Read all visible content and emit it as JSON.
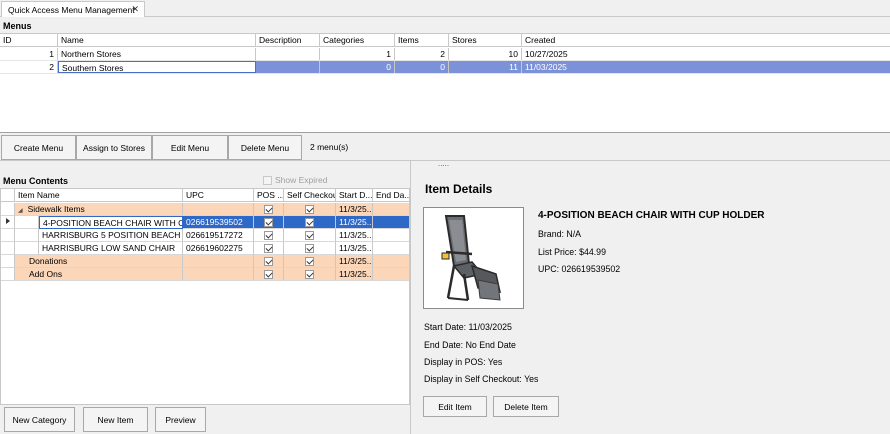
{
  "tab": {
    "title": "Quick Access Menu Management",
    "close": "✕"
  },
  "menus": {
    "title": "Menus",
    "columns": [
      "ID",
      "Name",
      "Description",
      "Categories",
      "Items",
      "Stores",
      "Created"
    ],
    "rows": [
      {
        "id": "1",
        "name": "Northern Stores",
        "description": "",
        "categories": "1",
        "items": "2",
        "stores": "10",
        "created": "10/27/2025",
        "selected": false
      },
      {
        "id": "2",
        "name": "Southern Stores",
        "description": "",
        "categories": "0",
        "items": "0",
        "stores": "11",
        "created": "11/03/2025",
        "selected": true
      }
    ]
  },
  "toolbar": {
    "create": "Create Menu",
    "assign": "Assign to Stores",
    "edit": "Edit Menu",
    "delete": "Delete Menu",
    "count": "2 menu(s)"
  },
  "splitter_handle": ".....",
  "contents": {
    "title": "Menu Contents",
    "show_expired": "Show Expired",
    "show_expired_checked": false,
    "columns": [
      "Item Name",
      "UPC",
      "POS ...",
      "Self Checkou...",
      "Start D...",
      "End Da..."
    ],
    "rows": [
      {
        "type": "category",
        "name": "Sidewalk Items",
        "upc": "",
        "pos": true,
        "self": true,
        "start": "11/3/25...",
        "end": "",
        "expander": "◢"
      },
      {
        "type": "item",
        "name": "4-POSITION BEACH CHAIR WITH CUP ...",
        "upc": "026619539502",
        "pos": true,
        "self": true,
        "start": "11/3/25...",
        "end": "",
        "selected": true
      },
      {
        "type": "item",
        "name": "HARRISBURG 5  POSITION BEACH CH...",
        "upc": "026619517272",
        "pos": true,
        "self": true,
        "start": "11/3/25...",
        "end": ""
      },
      {
        "type": "item",
        "name": "HARRISBURG LOW SAND CHAIR",
        "upc": "026619602275",
        "pos": true,
        "self": true,
        "start": "11/3/25...",
        "end": ""
      },
      {
        "type": "category",
        "name": "Donations",
        "upc": "",
        "pos": true,
        "self": true,
        "start": "11/3/25...",
        "end": ""
      },
      {
        "type": "category",
        "name": "Add Ons",
        "upc": "",
        "pos": true,
        "self": true,
        "start": "11/3/25...",
        "end": ""
      }
    ],
    "buttons": {
      "new_category": "New Category",
      "new_item": "New Item",
      "preview": "Preview"
    }
  },
  "details": {
    "title": "Item Details",
    "image_icon": "beach-chair-image",
    "item_name": "4-POSITION BEACH CHAIR WITH CUP HOLDER",
    "brand": "Brand: N/A",
    "list_price": "List Price: $44.99",
    "upc": "UPC: 026619539502",
    "start_date": "Start Date: 11/03/2025",
    "end_date": "End Date: No End Date",
    "display_pos": "Display in POS: Yes",
    "display_self": "Display in Self Checkout: Yes",
    "buttons": {
      "edit": "Edit Item",
      "delete": "Delete Item"
    }
  },
  "colors": {
    "selected_row": "#7b92d8",
    "selected_cell": "#2f69c8",
    "category_row": "#fbd6b8"
  }
}
